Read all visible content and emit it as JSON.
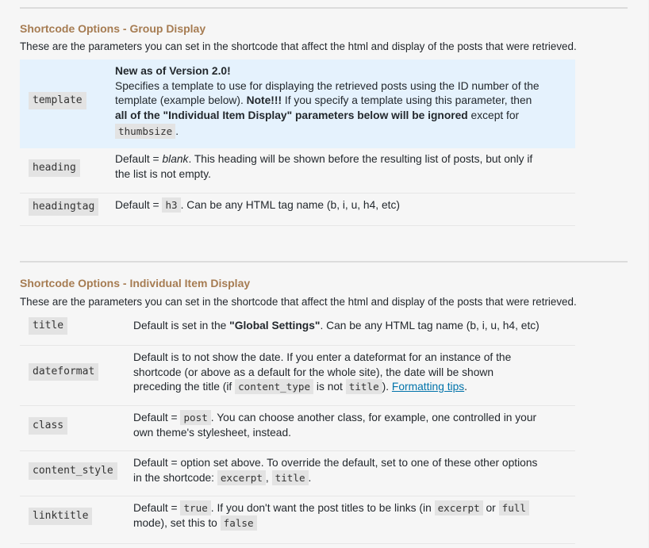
{
  "group_display": {
    "title": "Shortcode Options - Group Display",
    "description": "These are the parameters you can set in the shortcode that affect the html and display of the posts that were retrieved.",
    "rows": [
      {
        "param": "template",
        "new_note": "New as of Version 2.0!",
        "line1": "Specifies a template to use for displaying the retrieved posts using the ID number of the",
        "line2_a": "template (example below). ",
        "line2_b": "Note!!!",
        "line2_c": " If you specify a template using this parameter, then",
        "line3_a": "all of the \"Individual Item Display\" parameters below will be ignored",
        "line3_b": " except for",
        "code1": "thumbsize",
        "end": "."
      },
      {
        "param": "heading",
        "line1_a": "Default = ",
        "line1_em": "blank",
        "line1_b": ". This heading will be shown before the resulting list of posts, but only if",
        "line2": "the list is not empty."
      },
      {
        "param": "headingtag",
        "a": "Default = ",
        "code": "h3",
        "b": ". Can be any HTML tag name (b, i, u, h4, etc)"
      }
    ]
  },
  "item_display": {
    "title": "Shortcode Options - Individual Item Display",
    "description": "These are the parameters you can set in the shortcode that affect the html and display of the posts that were retrieved.",
    "rows": [
      {
        "param": "title",
        "a": "Default is set in the ",
        "bold": "\"Global Settings\"",
        "b": ". Can be any HTML tag name (b, i, u, h4, etc)"
      },
      {
        "param": "dateformat",
        "line1": "Default is to not show the date. If you enter a dateformat for an instance of the",
        "line2": "shortcode (or above as a default for the whole site), the date will be shown",
        "line3_a": "preceding the title (if ",
        "code1": "content_type",
        "line3_b": " is not ",
        "code2": "title",
        "line3_c": "). ",
        "link": "Formatting tips",
        "end": "."
      },
      {
        "param": "class",
        "a": "Default = ",
        "code": "post",
        "b": ". You can choose another class, for example, one controlled in your",
        "line2": "own theme's stylesheet, instead."
      },
      {
        "param": "content_style",
        "line1": "Default = option set above. To override the default, set to one of these other options",
        "line2_a": "in the shortcode: ",
        "code1": "excerpt",
        "comma": ",",
        "code2": "title",
        "end": "."
      },
      {
        "param": "linktitle",
        "a": "Default = ",
        "code1": "true",
        "b": ". If you don't want the post titles to be links (in ",
        "code2": "excerpt",
        "or": " or ",
        "code3": "full",
        "line2_a": "mode), set this to ",
        "code4": "false"
      }
    ]
  }
}
